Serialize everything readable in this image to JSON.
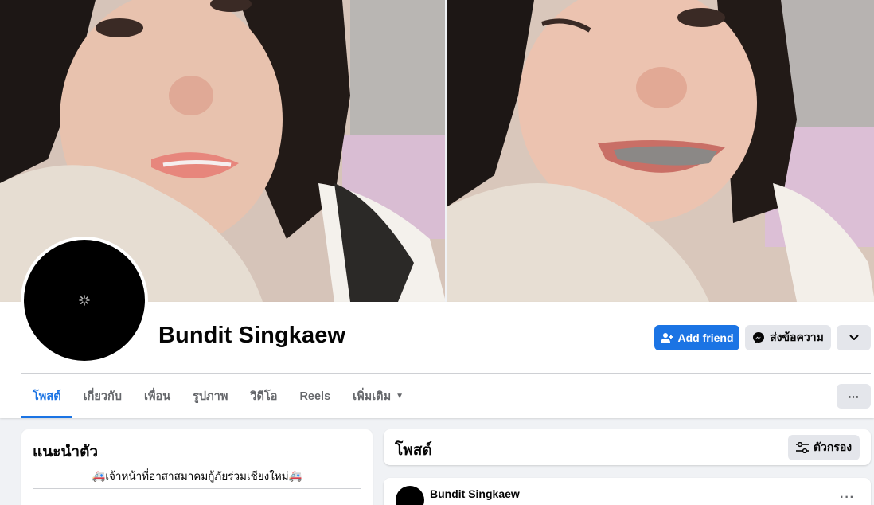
{
  "profile": {
    "name": "Bundit Singkaew",
    "bio": "🚑เจ้าหน้าที่อาสาสมาคมกู้ภัยร่วมเชียงใหม่🚑"
  },
  "actions": {
    "add_friend": "Add friend",
    "message": "ส่งข้อความ",
    "more_icon": "chevron-down-icon"
  },
  "tabs": [
    {
      "label": "โพสต์",
      "active": true
    },
    {
      "label": "เกี่ยวกับ",
      "active": false
    },
    {
      "label": "เพื่อน",
      "active": false
    },
    {
      "label": "รูปภาพ",
      "active": false
    },
    {
      "label": "วิดีโอ",
      "active": false
    },
    {
      "label": "Reels",
      "active": false
    },
    {
      "label": "เพิ่มเติม",
      "active": false
    }
  ],
  "tabs_more": "···",
  "intro": {
    "title": "แนะนำตัว"
  },
  "posts": {
    "title": "โพสต์",
    "filter_label": "ตัวกรอง",
    "first_post": {
      "author": "Bundit Singkaew",
      "more": "···"
    }
  },
  "colors": {
    "accent": "#1b74e4",
    "button_gray": "#e4e6eb",
    "background": "#f0f2f5"
  }
}
